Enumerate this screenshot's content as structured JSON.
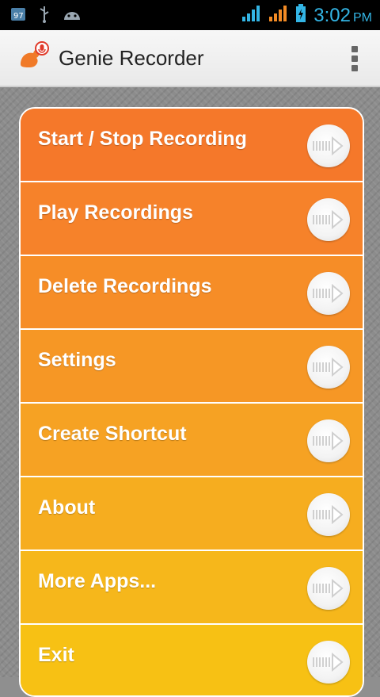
{
  "status_bar": {
    "time": "3:02",
    "ampm": "PM",
    "icons": [
      "notification-icon",
      "usb-icon",
      "android-icon",
      "signal-icon",
      "signal-icon-2",
      "battery-icon"
    ]
  },
  "app": {
    "title": "Genie Recorder",
    "icon": "microphone-logo-icon"
  },
  "colors": {
    "accent_top": "#f5772a",
    "accent_bottom": "#f7c214",
    "status_text": "#33b5e5"
  },
  "menu": {
    "items": [
      {
        "label": "Start / Stop Recording",
        "color": "#f5782a"
      },
      {
        "label": "Play Recordings",
        "color": "#f6822a"
      },
      {
        "label": "Delete Recordings",
        "color": "#f68d27"
      },
      {
        "label": "Settings",
        "color": "#f69725"
      },
      {
        "label": "Create Shortcut",
        "color": "#f6a223"
      },
      {
        "label": "About",
        "color": "#f6ad1f"
      },
      {
        "label": "More Apps...",
        "color": "#f6b71b"
      },
      {
        "label": "Exit",
        "color": "#f7c114"
      }
    ]
  }
}
